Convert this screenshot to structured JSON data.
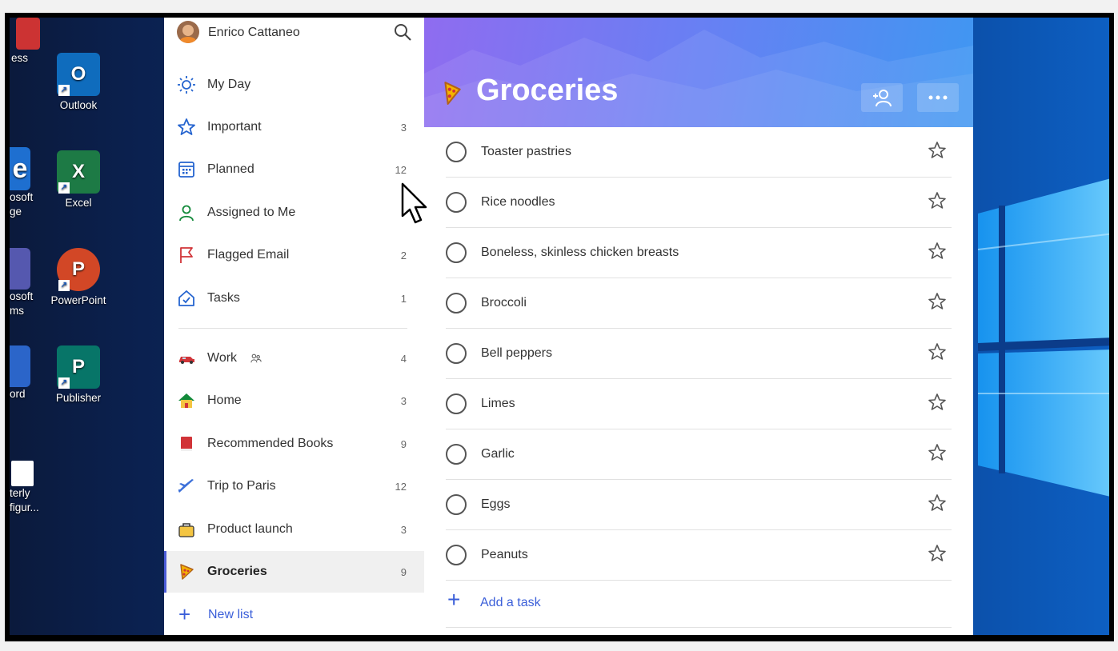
{
  "desktop": {
    "icons": [
      {
        "label": "Outlook",
        "icon": "outlook-icon",
        "color": "#0f6cbd",
        "letter": "O"
      },
      {
        "label": "Excel",
        "icon": "excel-icon",
        "color": "#1d7a45",
        "letter": "X"
      },
      {
        "label": "PowerPoint",
        "icon": "powerpoint-icon",
        "color": "#d24726",
        "letter": "P"
      },
      {
        "label": "Publisher",
        "icon": "publisher-icon",
        "color": "#077568",
        "letter": "P"
      }
    ],
    "partial_labels": [
      "ess",
      "osoft\nge",
      "osoft\nms",
      "ord",
      "terly\nfigur..."
    ]
  },
  "sidebar": {
    "user_name": "Enrico Cattaneo",
    "smart_lists": [
      {
        "label": "My Day",
        "icon": "sun-icon",
        "count": ""
      },
      {
        "label": "Important",
        "icon": "star-icon",
        "count": "3"
      },
      {
        "label": "Planned",
        "icon": "calendar-icon",
        "count": "12"
      },
      {
        "label": "Assigned to Me",
        "icon": "person-icon",
        "count": ""
      },
      {
        "label": "Flagged Email",
        "icon": "flag-icon",
        "count": "2"
      },
      {
        "label": "Tasks",
        "icon": "home-check-icon",
        "count": "1"
      }
    ],
    "lists": [
      {
        "label": "Work",
        "icon": "car-icon",
        "count": "4",
        "shared": true
      },
      {
        "label": "Home",
        "icon": "house-icon",
        "count": "3"
      },
      {
        "label": "Recommended Books",
        "icon": "book-icon",
        "count": "9"
      },
      {
        "label": "Trip to Paris",
        "icon": "airplane-icon",
        "count": "12"
      },
      {
        "label": "Product launch",
        "icon": "package-icon",
        "count": "3"
      },
      {
        "label": "Groceries",
        "icon": "pizza-icon",
        "count": "9",
        "active": true
      }
    ],
    "new_list_label": "New list"
  },
  "main": {
    "title": "Groceries",
    "tasks": [
      "Toaster pastries",
      "Rice noodles",
      "Boneless, skinless chicken breasts",
      "Broccoli",
      "Bell peppers",
      "Limes",
      "Garlic",
      "Eggs",
      "Peanuts"
    ],
    "add_task_label": "Add a task"
  },
  "colors": {
    "accent": "#3b5fd9",
    "header_start": "#8f6cf0",
    "header_end": "#3f97f2"
  }
}
